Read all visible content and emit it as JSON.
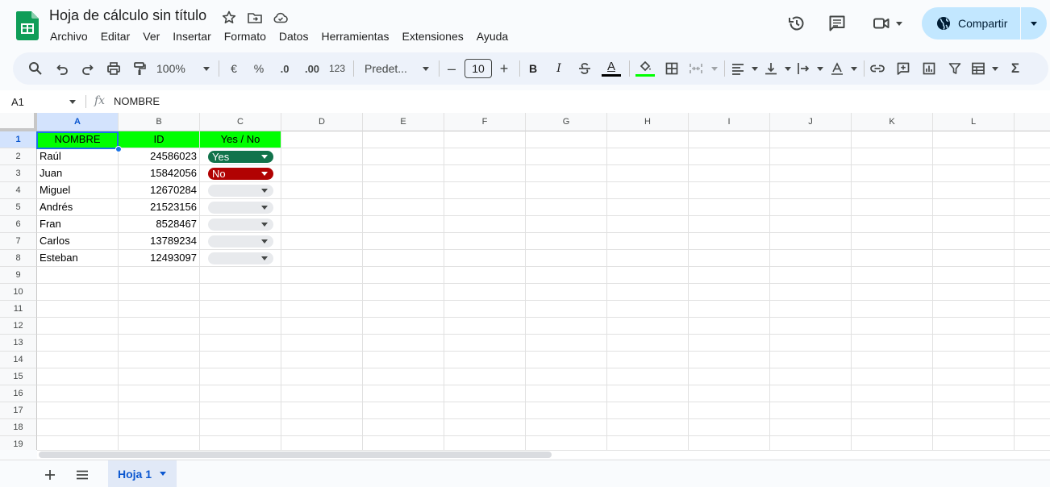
{
  "header": {
    "doc_title": "Hoja de cálculo sin título",
    "menu": [
      "Archivo",
      "Editar",
      "Ver",
      "Insertar",
      "Formato",
      "Datos",
      "Herramientas",
      "Extensiones",
      "Ayuda"
    ],
    "share_label": "Compartir"
  },
  "toolbar": {
    "zoom": "100%",
    "currency": "€",
    "percent": "%",
    "dec_decrease": ".0",
    "dec_increase": ".00",
    "number_format": "123",
    "font": "Predet...",
    "font_size": "10",
    "bold": "B",
    "italic": "I",
    "text_color": "A",
    "fill_color_hex": "#00ff00",
    "sigma": "Σ"
  },
  "formula_bar": {
    "name_box": "A1",
    "fx": "fx",
    "value": "NOMBRE"
  },
  "grid": {
    "columns": [
      "A",
      "B",
      "C",
      "D",
      "E",
      "F",
      "G",
      "H",
      "I",
      "J",
      "K",
      "L"
    ],
    "rows": [
      "1",
      "2",
      "3",
      "4",
      "5",
      "6",
      "7",
      "8",
      "9",
      "10",
      "11",
      "12",
      "13",
      "14",
      "15",
      "16",
      "17",
      "18",
      "19"
    ],
    "header_row": {
      "a": "NOMBRE",
      "b": "ID",
      "c": "Yes / No"
    },
    "data": [
      {
        "name": "Raúl",
        "id": "24586023",
        "choice": "Yes"
      },
      {
        "name": "Juan",
        "id": "15842056",
        "choice": "No"
      },
      {
        "name": "Miguel",
        "id": "12670284",
        "choice": ""
      },
      {
        "name": "Andrés",
        "id": "21523156",
        "choice": ""
      },
      {
        "name": "Fran",
        "id": "8528467",
        "choice": ""
      },
      {
        "name": "Carlos",
        "id": "13789234",
        "choice": ""
      },
      {
        "name": "Esteban",
        "id": "12493097",
        "choice": ""
      }
    ],
    "chip_colors": {
      "Yes": "#11734b",
      "No": "#b10202",
      "empty": "#e8eaed"
    },
    "header_fill": "#00ff00"
  },
  "sheetbar": {
    "tab_label": "Hoja 1"
  }
}
